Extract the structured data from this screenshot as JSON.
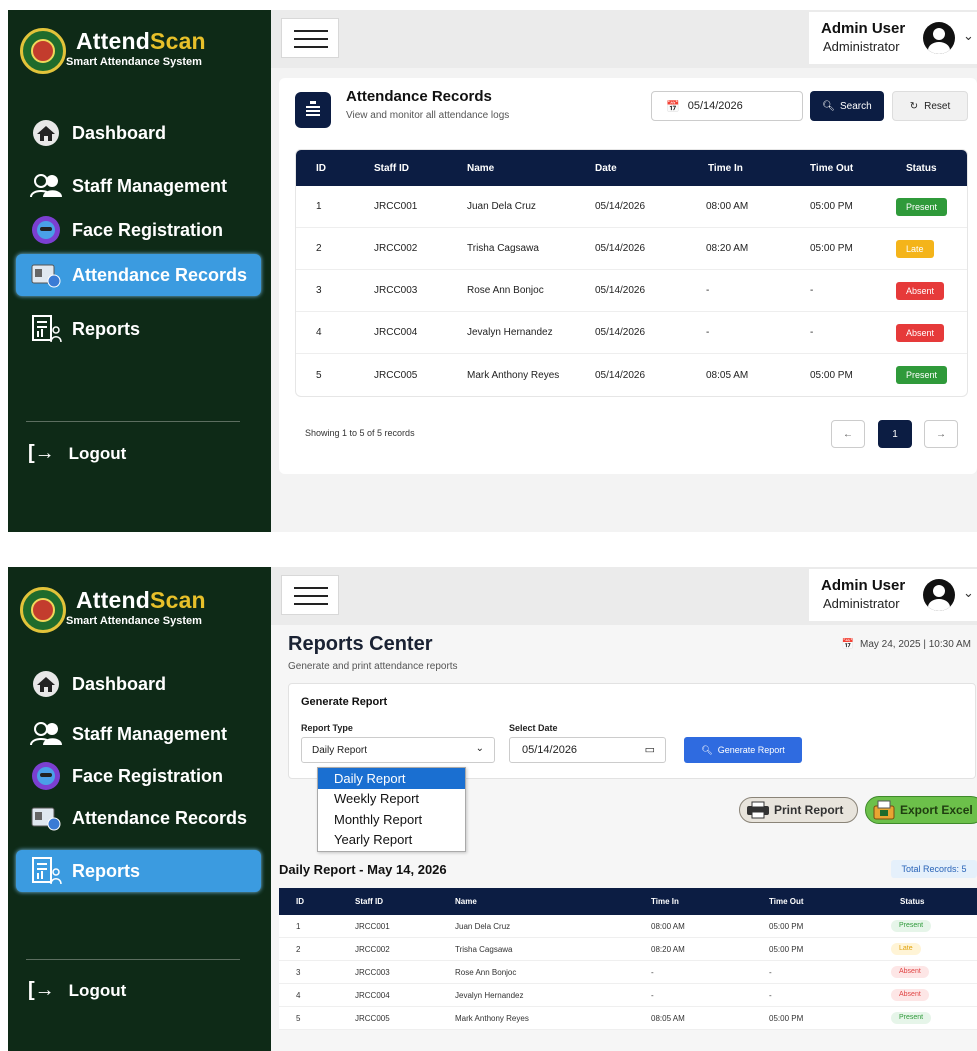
{
  "brand": {
    "name_main": "Attend",
    "name_accent": "Scan",
    "subtitle": "Smart Attendance System"
  },
  "sidebar": {
    "items": [
      {
        "label": "Dashboard",
        "icon": "home-icon"
      },
      {
        "label": "Staff Management",
        "icon": "users-icon"
      },
      {
        "label": "Face Registration",
        "icon": "face-icon"
      },
      {
        "label": "Attendance Records",
        "icon": "attendance-icon"
      },
      {
        "label": "Reports",
        "icon": "report-icon"
      }
    ],
    "logout_label": "Logout",
    "active_color": "#3b9be0",
    "bg_color": "#0e2a17"
  },
  "user": {
    "name": "Admin User",
    "role": "Administrator"
  },
  "attendance": {
    "title": "Attendance Records",
    "subtitle": "View and monitor all attendance logs",
    "date_value": "05/14/2026",
    "search_label": "Search",
    "reset_label": "Reset",
    "columns": [
      "ID",
      "Staff ID",
      "Name",
      "Date",
      "Time In",
      "Time Out",
      "Status"
    ],
    "rows": [
      [
        "1",
        "JRCC001",
        "Juan Dela Cruz",
        "05/14/2026",
        "08:00 AM",
        "05:00 PM",
        "Present"
      ],
      [
        "2",
        "JRCC002",
        "Trisha Cagsawa",
        "05/14/2026",
        "08:20 AM",
        "05:00 PM",
        "Late"
      ],
      [
        "3",
        "JRCC003",
        "Rose Ann Bonjoc",
        "05/14/2026",
        "-",
        "-",
        "Absent"
      ],
      [
        "4",
        "JRCC004",
        "Jevalyn Hernandez",
        "05/14/2026",
        "-",
        "-",
        "Absent"
      ],
      [
        "5",
        "JRCC005",
        "Mark Anthony Reyes",
        "05/14/2026",
        "08:05 AM",
        "05:00 PM",
        "Present"
      ]
    ],
    "showing": "Showing 1 to 5 of 5 records",
    "pagination": {
      "prev": "←",
      "current": "1",
      "next": "→"
    }
  },
  "reports": {
    "title": "Reports Center",
    "subtitle": "Generate and print attendance reports",
    "datetime": "May 24, 2025 | 10:30 AM",
    "generate_title": "Generate Report",
    "report_type_label": "Report Type",
    "report_type_value": "Daily Report",
    "select_date_label": "Select Date",
    "select_date_value": "05/14/2026",
    "generate_button": "Generate Report",
    "options": [
      "Daily Report",
      "Weekly Report",
      "Monthly Report",
      "Yearly Report"
    ],
    "print_label": "Print Report",
    "excel_label": "Export Excel",
    "daily_title": "Daily Report - May 14, 2026",
    "total_records": "Total Records: 5",
    "columns": [
      "ID",
      "Staff ID",
      "Name",
      "Time In",
      "Time Out",
      "Status"
    ],
    "rows": [
      [
        "1",
        "JRCC001",
        "Juan Dela Cruz",
        "08:00 AM",
        "05:00 PM",
        "Present"
      ],
      [
        "2",
        "JRCC002",
        "Trisha Cagsawa",
        "08:20 AM",
        "05:00 PM",
        "Late"
      ],
      [
        "3",
        "JRCC003",
        "Rose Ann Bonjoc",
        "-",
        "-",
        "Absent"
      ],
      [
        "4",
        "JRCC004",
        "Jevalyn Hernandez",
        "-",
        "-",
        "Absent"
      ],
      [
        "5",
        "JRCC005",
        "Mark Anthony Reyes",
        "08:05 AM",
        "05:00 PM",
        "Present"
      ]
    ]
  }
}
